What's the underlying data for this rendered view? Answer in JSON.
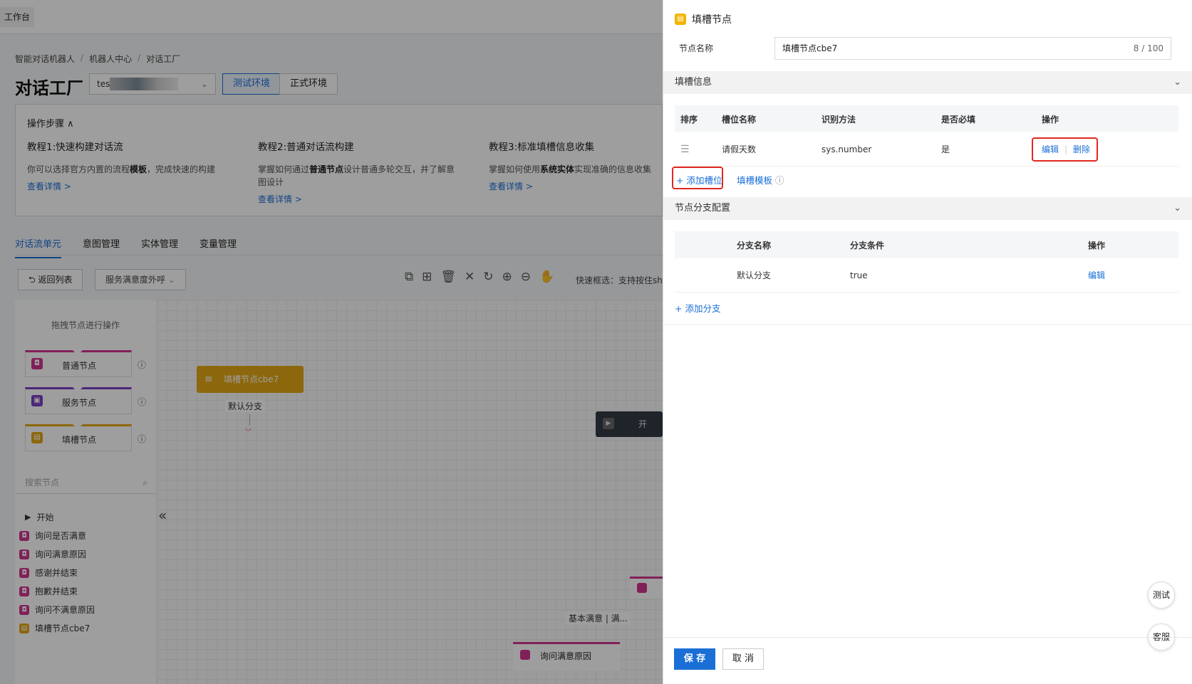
{
  "topbar": {
    "workbench": "工作台"
  },
  "breadcrumb": [
    "智能对话机器人",
    "机器人中心",
    "对话工厂"
  ],
  "page_title": "对话工厂",
  "bot_select": {
    "value": "tes"
  },
  "env": {
    "test": "测试环境",
    "prod": "正式环境"
  },
  "steps": {
    "header": "操作步骤",
    "items": [
      {
        "title": "教程1:快速构建对话流",
        "desc_pre": "你可以选择官方内置的流程",
        "desc_bold": "模板",
        "desc_post": "，完成快速的构建",
        "link": "查看详情 >"
      },
      {
        "title": "教程2:普通对话流构建",
        "desc_pre": "掌握如何通过",
        "desc_bold": "普通节点",
        "desc_post": "设计普通多轮交互，并了解意图设计",
        "link": "查看详情 >"
      },
      {
        "title": "教程3:标准填槽信息收集",
        "desc_pre": "掌握如何使用",
        "desc_bold": "系统实体",
        "desc_post": "实现准确的信息收集",
        "link": "查看详情 >"
      }
    ]
  },
  "main_tabs": [
    "对话流单元",
    "意图管理",
    "实体管理",
    "变量管理"
  ],
  "toolbar": {
    "back": "返回列表",
    "flow_select": "服务满意度外呼",
    "quick_tip": "快速框选：支持按住sh"
  },
  "palette": {
    "hint": "拖拽节点进行操作",
    "nodes": [
      {
        "label": "普通节点",
        "color": "#d1348f"
      },
      {
        "label": "服务节点",
        "color": "#7b3fc4"
      },
      {
        "label": "填槽节点",
        "color": "#e3a614"
      }
    ],
    "search_placeholder": "搜索节点"
  },
  "tree": {
    "start": "开始",
    "items": [
      {
        "label": "询问是否满意",
        "color": "#d1348f"
      },
      {
        "label": "询问满意原因",
        "color": "#d1348f"
      },
      {
        "label": "感谢并结束",
        "color": "#d1348f"
      },
      {
        "label": "抱歉并结束",
        "color": "#d1348f"
      },
      {
        "label": "询问不满意原因",
        "color": "#d1348f"
      },
      {
        "label": "填槽节点cbe7",
        "color": "#e3a614"
      }
    ]
  },
  "canvas": {
    "node_label": "填槽节点cbe7",
    "branch_label": "默认分支",
    "start_label": "开",
    "edge_label": "基本满意 | 满...",
    "bottom_node": "询问满意原因"
  },
  "drawer": {
    "title": "填槽节点",
    "node_name_label": "节点名称",
    "node_name_value": "填槽节点cbe7",
    "node_name_count": "8 / 100",
    "slot_section": "填槽信息",
    "slot_headers": [
      "排序",
      "槽位名称",
      "识别方法",
      "是否必填",
      "操作"
    ],
    "slot_rows": [
      {
        "name": "请假天数",
        "method": "sys.number",
        "required": "是",
        "edit": "编辑",
        "delete": "删除"
      }
    ],
    "add_slot": "+ 添加槽位",
    "slot_template": "填槽模板",
    "branch_section": "节点分支配置",
    "branch_headers": [
      "分支名称",
      "分支条件",
      "操作"
    ],
    "branch_rows": [
      {
        "name": "默认分支",
        "condition": "true",
        "edit": "编辑"
      }
    ],
    "add_branch": "+ 添加分支",
    "save": "保 存",
    "cancel": "取 消",
    "float_test": "测试",
    "float_service": "客服"
  }
}
